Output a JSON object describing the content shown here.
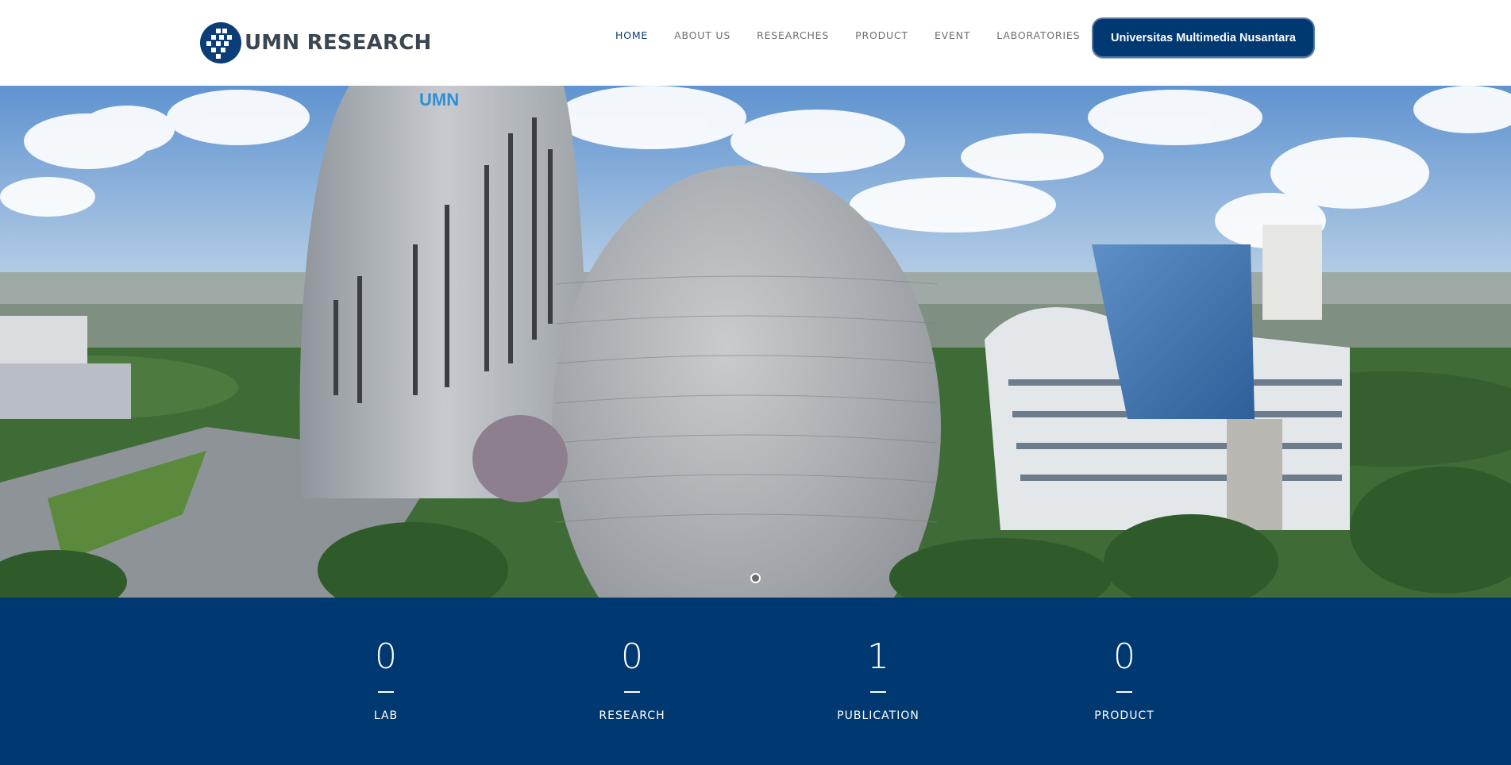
{
  "brand": {
    "name": "UMN RESEARCH",
    "logo_icon": "umn-logo-icon",
    "color": "#0b3d78"
  },
  "nav": {
    "items": [
      {
        "label": "HOME",
        "active": true
      },
      {
        "label": "ABOUT US",
        "active": false
      },
      {
        "label": "RESEARCHES",
        "active": false
      },
      {
        "label": "PRODUCT",
        "active": false
      },
      {
        "label": "EVENT",
        "active": false
      },
      {
        "label": "LABORATORIES",
        "active": false
      }
    ]
  },
  "cta": {
    "label": "Universitas Multimedia Nusantara",
    "color": "#003872"
  },
  "hero": {
    "signage": "UMN",
    "slides_count": 1,
    "active_slide": 1
  },
  "stats": [
    {
      "value": "0",
      "label": "LAB"
    },
    {
      "value": "0",
      "label": "RESEARCH"
    },
    {
      "value": "1",
      "label": "PUBLICATION"
    },
    {
      "value": "0",
      "label": "PRODUCT"
    }
  ],
  "colors": {
    "accent": "#003872",
    "nav_text": "#707070",
    "nav_active": "#0b3d78"
  }
}
